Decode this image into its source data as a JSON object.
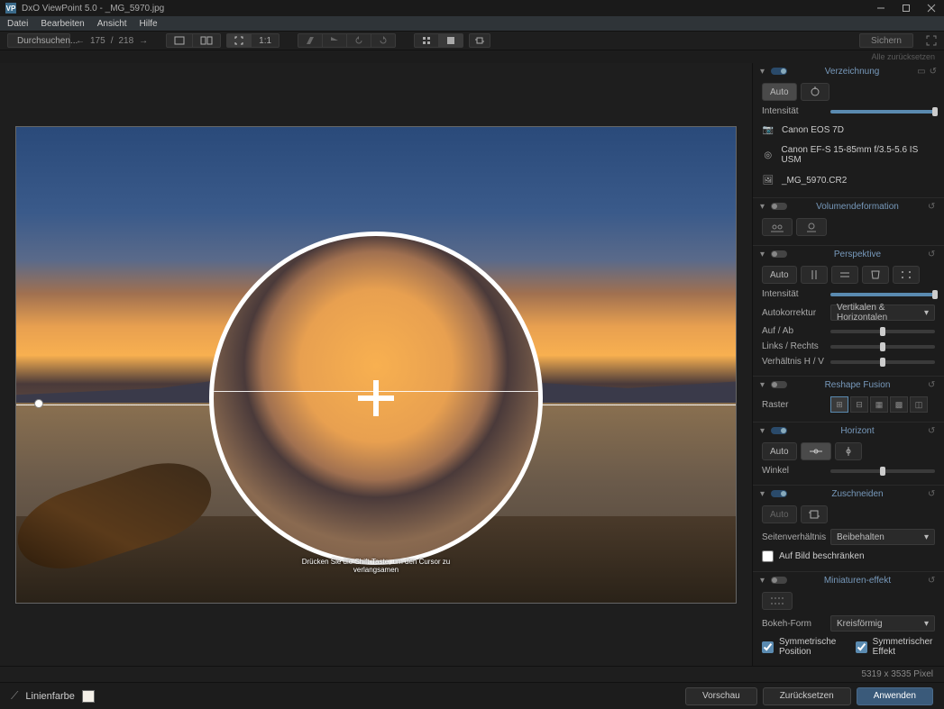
{
  "titlebar": {
    "title": "DxO ViewPoint 5.0 - _MG_5970.jpg"
  },
  "menu": {
    "file": "Datei",
    "edit": "Bearbeiten",
    "view": "Ansicht",
    "help": "Hilfe"
  },
  "toolbar": {
    "browse": "Durchsuchen...",
    "page_current": "175",
    "page_sep": "/",
    "page_total": "218",
    "one_to_one": "1:1",
    "save": "Sichern",
    "reset_all": "Alle zurücksetzen"
  },
  "hint": {
    "line1": "Drücken Sie die Shift-Taste, um den Cursor zu",
    "line2": "verlangsamen"
  },
  "panels": {
    "distortion": {
      "title": "Verzeichnung",
      "auto": "Auto",
      "intensity": "Intensität",
      "camera": "Canon EOS 7D",
      "lens": "Canon EF-S 15-85mm f/3.5-5.6 IS USM",
      "file": "_MG_5970.CR2"
    },
    "volume": {
      "title": "Volumendeformation"
    },
    "perspective": {
      "title": "Perspektive",
      "auto": "Auto",
      "intensity": "Intensität",
      "autocorrect_label": "Autokorrektur",
      "autocorrect_value": "Vertikalen & Horizontalen",
      "updown": "Auf / Ab",
      "leftright": "Links / Rechts",
      "ratio": "Verhältnis H / V"
    },
    "reshape": {
      "title": "Reshape Fusion",
      "grid": "Raster"
    },
    "horizon": {
      "title": "Horizont",
      "auto": "Auto",
      "angle": "Winkel"
    },
    "crop": {
      "title": "Zuschneiden",
      "auto": "Auto",
      "aspect_label": "Seitenverhältnis",
      "aspect_value": "Beibehalten",
      "constrain": "Auf Bild beschränken"
    },
    "miniature": {
      "title": "Miniaturen-effekt",
      "bokeh_label": "Bokeh-Form",
      "bokeh_value": "Kreisförmig",
      "sym_pos": "Symmetrische Position",
      "sym_eff": "Symmetrischer Effekt"
    }
  },
  "status": {
    "dimensions": "5319 x 3535 Pixel"
  },
  "bottom": {
    "linecolor": "Linienfarbe",
    "preview": "Vorschau",
    "reset": "Zurücksetzen",
    "apply": "Anwenden"
  }
}
